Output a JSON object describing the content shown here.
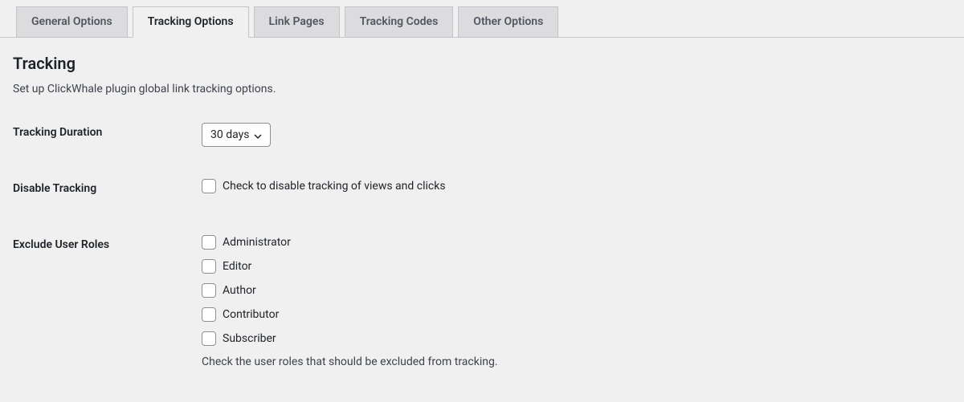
{
  "tabs": [
    {
      "label": "General Options",
      "active": false
    },
    {
      "label": "Tracking Options",
      "active": true
    },
    {
      "label": "Link Pages",
      "active": false
    },
    {
      "label": "Tracking Codes",
      "active": false
    },
    {
      "label": "Other Options",
      "active": false
    }
  ],
  "section": {
    "title": "Tracking",
    "description": "Set up ClickWhale plugin global link tracking options."
  },
  "fields": {
    "tracking_duration": {
      "label": "Tracking Duration",
      "value": "30 days"
    },
    "disable_tracking": {
      "label": "Disable Tracking",
      "checkbox_label": "Check to disable tracking of views and clicks",
      "checked": false
    },
    "exclude_roles": {
      "label": "Exclude User Roles",
      "options": [
        {
          "label": "Administrator",
          "checked": false
        },
        {
          "label": "Editor",
          "checked": false
        },
        {
          "label": "Author",
          "checked": false
        },
        {
          "label": "Contributor",
          "checked": false
        },
        {
          "label": "Subscriber",
          "checked": false
        }
      ],
      "help": "Check the user roles that should be excluded from tracking."
    }
  }
}
